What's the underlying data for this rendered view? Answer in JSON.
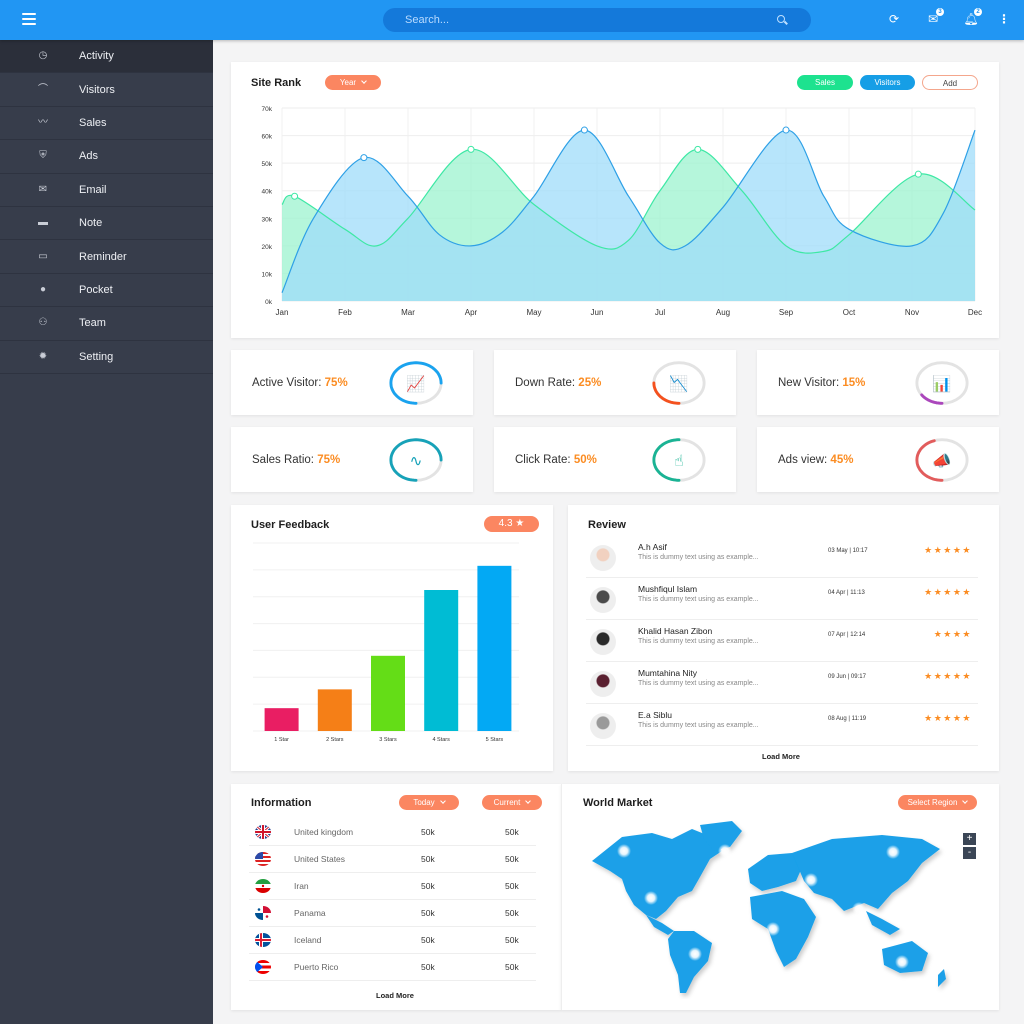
{
  "topbar": {
    "search_placeholder": "Search...",
    "icons": [
      "menu-icon",
      "search-icon",
      "refresh-icon",
      "mail-icon",
      "notification-icon",
      "more-vertical-icon"
    ],
    "mail_badge": "3",
    "notification_badge": "2"
  },
  "sidebar": {
    "items": [
      {
        "label": "Activity",
        "icon": "activity-icon",
        "glyph": "◷",
        "active": true
      },
      {
        "label": "Visitors",
        "icon": "visitors-icon",
        "glyph": "⌒"
      },
      {
        "label": "Sales",
        "icon": "trending-up-icon",
        "glyph": "〰"
      },
      {
        "label": "Ads",
        "icon": "shield-icon",
        "glyph": "⛨"
      },
      {
        "label": "Email",
        "icon": "email-icon",
        "glyph": "✉"
      },
      {
        "label": "Note",
        "icon": "note-icon",
        "glyph": "▬"
      },
      {
        "label": "Reminder",
        "icon": "calendar-icon",
        "glyph": "▭"
      },
      {
        "label": "Pocket",
        "icon": "pocket-icon",
        "glyph": "●"
      },
      {
        "label": "Team",
        "icon": "team-icon",
        "glyph": "⚇"
      },
      {
        "label": "Setting",
        "icon": "gear-icon",
        "glyph": "✹"
      }
    ]
  },
  "site_rank": {
    "title": "Site Rank",
    "period_label": "Year",
    "sales_label": "Sales",
    "visitors_label": "Visitors",
    "add_label": "Add"
  },
  "chart_data": {
    "type": "area",
    "title": "Site Rank",
    "x": [
      "Jan",
      "Feb",
      "Mar",
      "Apr",
      "May",
      "Jun",
      "Jul",
      "Aug",
      "Sep",
      "Oct",
      "Nov",
      "Dec"
    ],
    "yticks": [
      "0k",
      "10k",
      "20k",
      "30k",
      "40k",
      "50k",
      "60k",
      "70k"
    ],
    "ylim": [
      0,
      70
    ],
    "yunit": "k",
    "grid": true,
    "series": [
      {
        "name": "Sales",
        "color": "#3ee8a5",
        "fill": "#9cf3cf",
        "points": [
          [
            0,
            35
          ],
          [
            0.2,
            38
          ],
          [
            1,
            26
          ],
          [
            1.5,
            20
          ],
          [
            2,
            30
          ],
          [
            3,
            55
          ],
          [
            4,
            35
          ],
          [
            5,
            20
          ],
          [
            5.5,
            22
          ],
          [
            6,
            40
          ],
          [
            6.6,
            55
          ],
          [
            7.3,
            40
          ],
          [
            8,
            20
          ],
          [
            8.6,
            18
          ],
          [
            9,
            24
          ],
          [
            10.1,
            46
          ],
          [
            11,
            33
          ]
        ],
        "markers": [
          [
            0.2,
            38
          ],
          [
            3,
            55
          ],
          [
            6.6,
            55
          ],
          [
            10.1,
            46
          ]
        ]
      },
      {
        "name": "Visitors",
        "color": "#2ea0e6",
        "fill": "#9fdcfa",
        "points": [
          [
            0,
            3
          ],
          [
            0.5,
            30
          ],
          [
            1.3,
            52
          ],
          [
            2,
            38
          ],
          [
            2.5,
            24
          ],
          [
            3,
            20
          ],
          [
            3.5,
            25
          ],
          [
            4,
            38
          ],
          [
            4.8,
            62
          ],
          [
            5.5,
            38
          ],
          [
            6,
            21
          ],
          [
            6.4,
            20
          ],
          [
            7,
            34
          ],
          [
            8,
            62
          ],
          [
            8.6,
            38
          ],
          [
            9,
            26
          ],
          [
            10,
            20
          ],
          [
            10.5,
            32
          ],
          [
            11,
            62
          ]
        ],
        "markers": [
          [
            1.3,
            52
          ],
          [
            4.8,
            62
          ],
          [
            8,
            62
          ]
        ]
      }
    ]
  },
  "stats": [
    {
      "label": "Active Visitor:",
      "value": "75%",
      "percent": 75,
      "color": "#1aa3ef",
      "icon": "chart-growth-icon",
      "glyph": "📈"
    },
    {
      "label": "Down Rate:",
      "value": "25%",
      "percent": 25,
      "color": "#f4511e",
      "icon": "chart-decline-icon",
      "glyph": "📉"
    },
    {
      "label": "New Visitor:",
      "value": "15%",
      "percent": 15,
      "color": "#ab47bc",
      "icon": "bar-growth-icon",
      "glyph": "📊"
    },
    {
      "label": "Sales Ratio:",
      "value": "75%",
      "percent": 75,
      "color": "#17a2b8",
      "icon": "line-nodes-icon",
      "glyph": "∿"
    },
    {
      "label": "Click Rate:",
      "value": "50%",
      "percent": 50,
      "color": "#1ab394",
      "icon": "tap-icon",
      "glyph": "☝"
    },
    {
      "label": "Ads view:",
      "value": "45%",
      "percent": 45,
      "color": "#e25c5c",
      "icon": "megaphone-icon",
      "glyph": "📣"
    }
  ],
  "feedback": {
    "title": "User Feedback",
    "rating": "4.3 ★",
    "chart": {
      "type": "bar",
      "categories": [
        "1 Star",
        "2 Stars",
        "3 Stars",
        "4 Stars",
        "5 Stars"
      ],
      "values": [
        0.85,
        1.55,
        2.8,
        5.25,
        6.15
      ],
      "colors": [
        "#e91e63",
        "#f57f17",
        "#64dd17",
        "#00bcd4",
        "#03a9f4"
      ],
      "ylim": [
        0,
        7
      ]
    }
  },
  "review": {
    "title": "Review",
    "load_more": "Load More",
    "items": [
      {
        "name": "A.h Asif",
        "text": "This is dummy text using as example...",
        "date": "03 May | 10:17",
        "stars": "★★★★★",
        "rating": 5
      },
      {
        "name": "Mushfiqul Islam",
        "text": "This is dummy text using as example...",
        "date": "04 Apr | 11:13",
        "stars": "★★★★★",
        "rating": 5
      },
      {
        "name": "Khalid Hasan Zibon",
        "text": "This is dummy text using as example...",
        "date": "07 Apr | 12:14",
        "stars": "★★★★",
        "rating": 4
      },
      {
        "name": "Mumtahina Nity",
        "text": "This is dummy text using as example...",
        "date": "09 Jun | 09:17",
        "stars": "★★★★★",
        "rating": 5
      },
      {
        "name": "E.a Siblu",
        "text": "This is dummy text using as example...",
        "date": "08 Aug | 11:19",
        "stars": "★★★★★",
        "rating": 5
      }
    ]
  },
  "information": {
    "title": "Information",
    "filter1": "Today",
    "filter2": "Current",
    "load_more": "Load More",
    "rows": [
      {
        "country": "United kingdom",
        "today": "50k",
        "current": "50k",
        "flag": "uk"
      },
      {
        "country": "United States",
        "today": "50k",
        "current": "50k",
        "flag": "us"
      },
      {
        "country": "Iran",
        "today": "50k",
        "current": "50k",
        "flag": "iran"
      },
      {
        "country": "Panama",
        "today": "50k",
        "current": "50k",
        "flag": "panama"
      },
      {
        "country": "Iceland",
        "today": "50k",
        "current": "50k",
        "flag": "iceland"
      },
      {
        "country": "Puerto Rico",
        "today": "50k",
        "current": "50k",
        "flag": "puerto-rico"
      }
    ]
  },
  "world_market": {
    "title": "World Market",
    "select_label": "Select Region",
    "zoom_in": "+",
    "zoom_out": "-",
    "map_color": "#1aa0e8"
  },
  "colors": {
    "accent": "#2196f3",
    "orange": "#fb8661",
    "sidebar": "#373d4b"
  }
}
